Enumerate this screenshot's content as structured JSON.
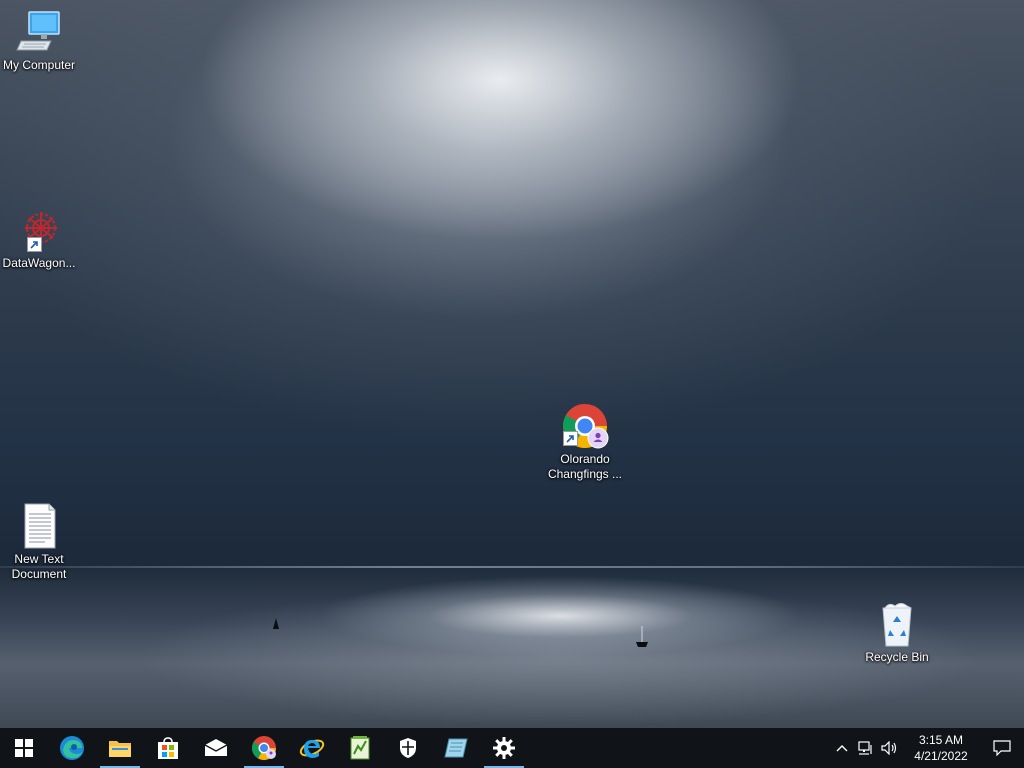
{
  "desktop": {
    "icons": {
      "my_computer": "My Computer",
      "datawagon": "DataWagon...",
      "chrome_profile_line1": "Olorando",
      "chrome_profile_line2": "Changfings ...",
      "new_text_line1": "New Text",
      "new_text_line2": "Document",
      "recycle_bin": "Recycle Bin"
    }
  },
  "taskbar": {
    "apps": [
      {
        "icon": "windows-start-icon",
        "running": false
      },
      {
        "icon": "edge-icon",
        "running": false
      },
      {
        "icon": "file-explorer-icon",
        "running": true
      },
      {
        "icon": "microsoft-store-icon",
        "running": false
      },
      {
        "icon": "mail-icon",
        "running": false
      },
      {
        "icon": "chrome-icon",
        "running": true
      },
      {
        "icon": "internet-explorer-icon",
        "running": false
      },
      {
        "icon": "notepad-chart-icon",
        "running": false
      },
      {
        "icon": "windows-security-icon",
        "running": false
      },
      {
        "icon": "sticky-tool-icon",
        "running": false
      },
      {
        "icon": "settings-gear-icon",
        "running": true
      }
    ],
    "clock": {
      "time": "3:15 AM",
      "date": "4/21/2022"
    }
  },
  "colors": {
    "taskbar_bg": "#101418",
    "running_indicator": "#76b9ed"
  }
}
